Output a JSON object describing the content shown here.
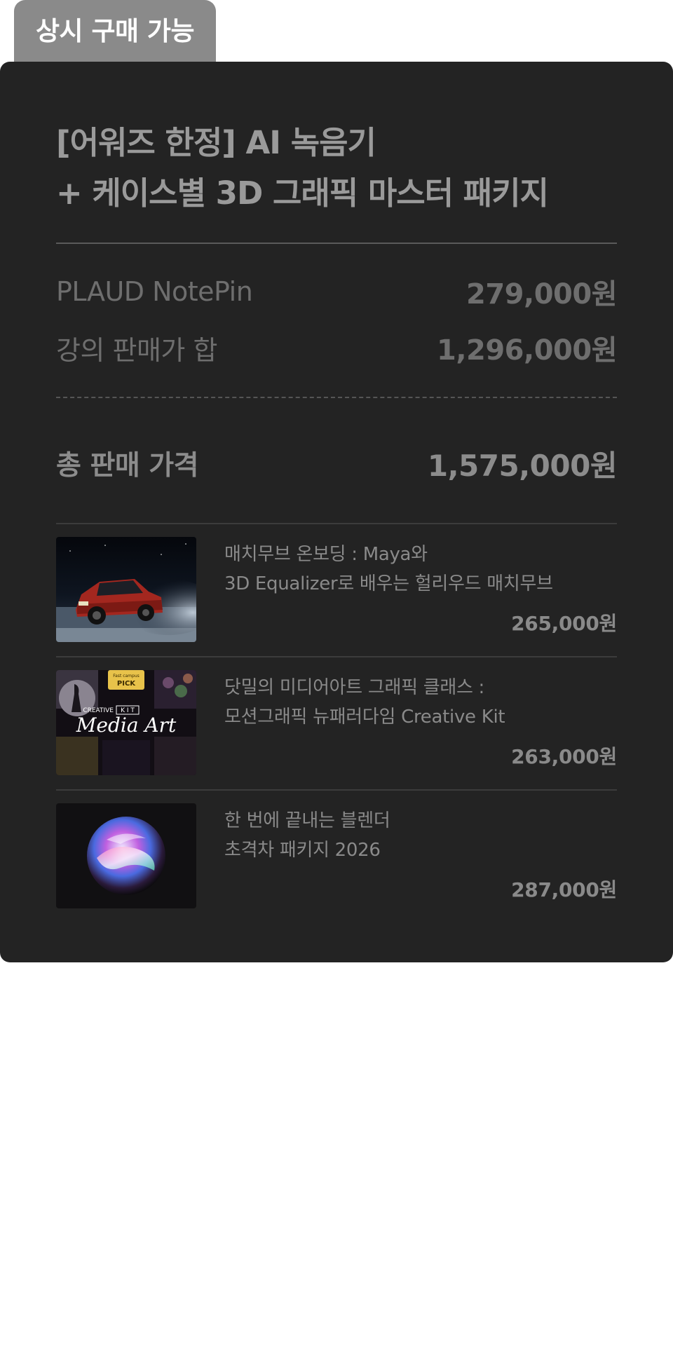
{
  "tab": {
    "label": "상시 구매 가능"
  },
  "package": {
    "title_line1": "[어워즈 한정] AI 녹음기",
    "title_line2": "+ 케이스별 3D 그래픽 마스터 패키지"
  },
  "breakdown": {
    "device_label": "PLAUD NotePin",
    "device_price": "279,000원",
    "lectures_label": "강의 판매가 합",
    "lectures_price": "1,296,000원"
  },
  "total": {
    "label": "총 판매 가격",
    "price": "1,575,000원"
  },
  "courses": [
    {
      "thumbnail_icon": "red-car-drift-image",
      "name_line1": "매치무브 온보딩 : Maya와",
      "name_line2": "3D Equalizer로 배우는 헐리우드 매치무브",
      "price": "265,000원"
    },
    {
      "thumbnail_icon": "media-art-cover-image",
      "thumb_badge_top": "Fast campus",
      "thumb_badge": "PICK",
      "thumb_kit_label": "CREATIVE",
      "thumb_kit_letters": "K I T",
      "thumb_title": "Media Art",
      "name_line1": "닷밀의 미디어아트 그래픽 클래스 :",
      "name_line2": "모션그래픽 뉴패러다임 Creative Kit",
      "price": "263,000원"
    },
    {
      "thumbnail_icon": "iridescent-3d-blob-image",
      "name_line1": "한 번에 끝내는 블렌더",
      "name_line2": "초격차 패키지 2026",
      "price": "287,000원"
    }
  ],
  "colors": {
    "card_background": "#232323",
    "tab_background": "#8a8a8a",
    "text_muted": "#6e6e6e",
    "page_background": "#ffffff"
  }
}
